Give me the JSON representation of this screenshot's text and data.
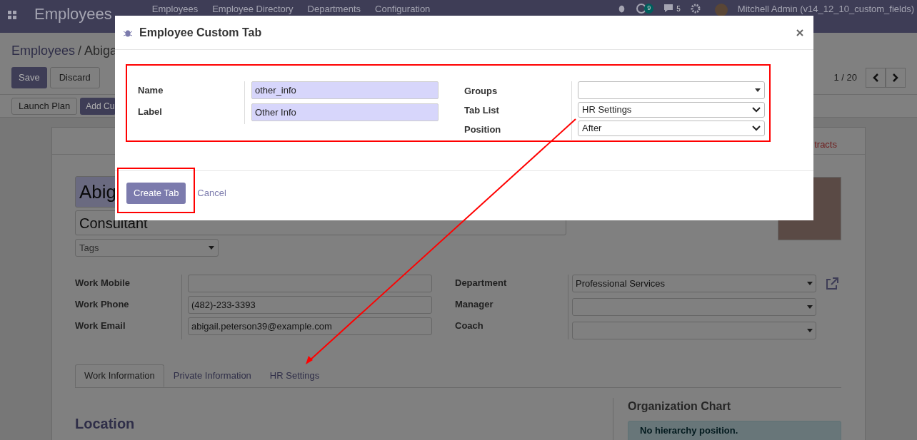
{
  "navbar": {
    "app_title": "Employees",
    "menu": [
      "Employees",
      "Employee Directory",
      "Departments",
      "Configuration"
    ],
    "activity_count": "9",
    "message_count": "5",
    "user": "Mitchell Admin (v14_12_10_custom_fields)"
  },
  "breadcrumb": [
    "Employees",
    "/",
    "Abiga"
  ],
  "actions": {
    "save": "Save",
    "discard": "Discard"
  },
  "pager": "1 / 20",
  "header_buttons": [
    "Launch Plan",
    "Add Cu"
  ],
  "form": {
    "smart_button": "tracts",
    "name": "Abig",
    "job_title": "Consultant",
    "tags_placeholder": "Tags",
    "left_fields": [
      {
        "label": "Work Mobile"
      },
      {
        "label": "Work Phone",
        "value": "(482)-233-3393"
      },
      {
        "label": "Work Email",
        "value": "abigail.peterson39@example.com"
      }
    ],
    "right_fields": [
      {
        "label": "Department",
        "value": "Professional Services",
        "external_link": true
      },
      {
        "label": "Manager",
        "external_link": false
      },
      {
        "label": "Coach",
        "external_link": false
      }
    ],
    "tabs": [
      {
        "label": "Work Information",
        "selected": true
      },
      {
        "label": "Private Information",
        "selected": false
      },
      {
        "label": "HR Settings",
        "selected": false
      }
    ],
    "section_title": "Location",
    "org_chart_title": "Organization Chart",
    "org_chart_message": "No hierarchy position."
  },
  "dialog": {
    "title": "Employee Custom Tab",
    "left_fields": [
      {
        "label": "Name",
        "value": "other_info"
      },
      {
        "label": "Label",
        "value": "Other Info"
      }
    ],
    "right_fields": [
      {
        "label": "Groups",
        "kind": "many2one"
      },
      {
        "label": "Tab List",
        "kind": "select",
        "value": "HR Settings"
      },
      {
        "label": "Position",
        "kind": "select",
        "value": "After"
      }
    ],
    "primary_button": "Create Tab",
    "cancel": "Cancel"
  }
}
